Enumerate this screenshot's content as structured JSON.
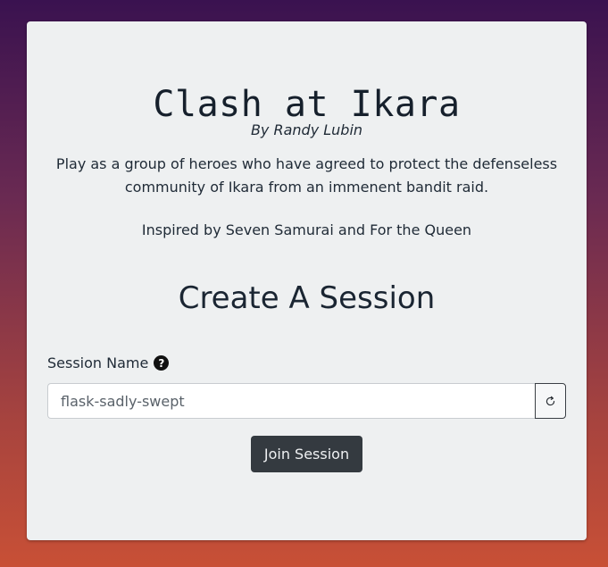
{
  "game": {
    "title": "Clash at Ikara",
    "byline": "By Randy Lubin",
    "description": "Play as a group of heroes who have agreed to protect the defenseless community of Ikara from an immenent bandit raid.",
    "inspired": "Inspired by Seven Samurai and For the Queen"
  },
  "session": {
    "heading": "Create A Session",
    "label": "Session Name",
    "help_icon": "question-circle-icon",
    "help_glyph": "?",
    "input_value": "flask-sadly-swept",
    "refresh_icon": "refresh-icon",
    "join_label": "Join Session"
  },
  "colors": {
    "background_top": "#3a1250",
    "background_bottom": "#c85036",
    "card": "#eef0f1",
    "button_dark": "#343a40"
  }
}
